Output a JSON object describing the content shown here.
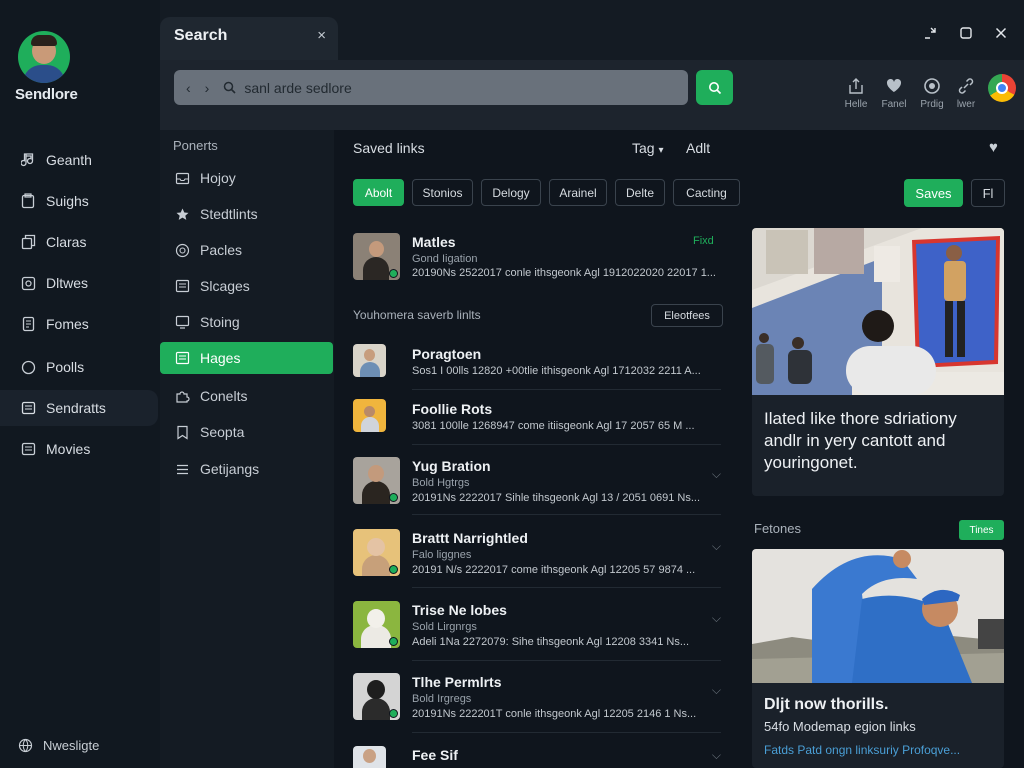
{
  "app": {
    "brand": "Sendlore"
  },
  "nav": {
    "items": [
      {
        "label": "Geanth",
        "icon": "music-note-icon"
      },
      {
        "label": "Suighs",
        "icon": "clipboard-icon"
      },
      {
        "label": "Claras",
        "icon": "copy-icon"
      },
      {
        "label": "Dltwes",
        "icon": "image-icon"
      },
      {
        "label": "Fomes",
        "icon": "document-icon"
      },
      {
        "label": "Poolls",
        "icon": "circle-icon"
      },
      {
        "label": "Sendratts",
        "icon": "list-icon"
      },
      {
        "label": "Movies",
        "icon": "list-icon"
      }
    ],
    "active_index": 6,
    "footer_label": "Nwesligte"
  },
  "tab": {
    "title": "Search",
    "close_glyph": "×"
  },
  "window": {
    "minimize": "minimize-icon",
    "restore": "restore-icon",
    "close": "close-icon"
  },
  "search": {
    "value": "sanl arde sedlore",
    "back": "‹",
    "forward": "›"
  },
  "toolbar": {
    "buttons": [
      {
        "label": "Helle",
        "icon": "upload-icon"
      },
      {
        "label": "Fanel",
        "icon": "heart-icon"
      },
      {
        "label": "Prdig",
        "icon": "record-icon"
      },
      {
        "label": "lwer",
        "icon": "link-icon"
      }
    ]
  },
  "folders": {
    "heading": "Ponerts",
    "items": [
      {
        "label": "Hojoy",
        "icon": "inbox-icon"
      },
      {
        "label": "Stedtlints",
        "icon": "star-icon"
      },
      {
        "label": "Pacles",
        "icon": "circle-icon"
      },
      {
        "label": "Slcages",
        "icon": "file-icon"
      },
      {
        "label": "Stoing",
        "icon": "monitor-icon"
      },
      {
        "label": "Hages",
        "icon": "stack-icon"
      },
      {
        "label": "Conelts",
        "icon": "puzzle-icon"
      },
      {
        "label": "Seopta",
        "icon": "bookmark-icon"
      },
      {
        "label": "Getijangs",
        "icon": "list-icon"
      }
    ],
    "active_index": 5
  },
  "main": {
    "title": "Saved links",
    "tag_dropdown": "Tag",
    "alt_label": "Adlt",
    "filters": [
      "Abolt",
      "Stonios",
      "Delogy",
      "Arainel",
      "Delte",
      "Cacting"
    ],
    "active_filter": 0,
    "saves_label": "Saves",
    "fi_label": "Fl",
    "top_item": {
      "title": "Matles",
      "subtitle": "Gond Iigation",
      "meta": "20190Ns 2522017 conle ithsgeonk Agl 1912022020 22017 1...",
      "action": "Fixd"
    },
    "section_title": "Youhomera saverb linlts",
    "section_button": "Eleotfees",
    "items": [
      {
        "title": "Poragtoen",
        "meta": "Sos1 I 00lls 12820 +00tlie ithisgeonk Agl 1712032 2211 A..."
      },
      {
        "title": "Foollie Rots",
        "meta": "3081 100lle 1268947 come itiisgeonk Agl 17 2057 65 M ..."
      },
      {
        "title": "Yug Bration",
        "subtitle": "Bold Hgtrgs",
        "meta": "20191Ns 2222017 Sihle tihsgeonk Agl 13 / 2051 0691 Ns..."
      },
      {
        "title": "Brattt Narrightled",
        "subtitle": "Falo liggnes",
        "meta": "20191 N/s 2222017 come ithsgeonk Agl 12205 57 9874 ..."
      },
      {
        "title": "Trise Ne lobes",
        "subtitle": "Sold Lirgnrgs",
        "meta": "Adeli 1Na 2272079: Sihe tihsgeonk Agl 12208 3341 Ns..."
      },
      {
        "title": "Tlhe Permlrts",
        "subtitle": "Bold Irgregs",
        "meta": "20191Ns 222201T conle ithsgeonk Agl 12205 2146 1 Ns..."
      },
      {
        "title": "Fee Sif",
        "subtitle": "",
        "meta": ""
      }
    ]
  },
  "right": {
    "card1_text": "Ilated like thore sdriationy andlr in yery cantott and youringonet.",
    "section_label": "Fetones",
    "section_badge": "Tines",
    "card2_title": "Dljt now thorills.",
    "card2_subtitle": "54fo Modemap egion links",
    "card2_link": "Fatds Patd ongn linksuriy Profoqve..."
  },
  "colors": {
    "accent": "#1fae5b",
    "background": "#0f151d",
    "panel": "#1a212a"
  }
}
